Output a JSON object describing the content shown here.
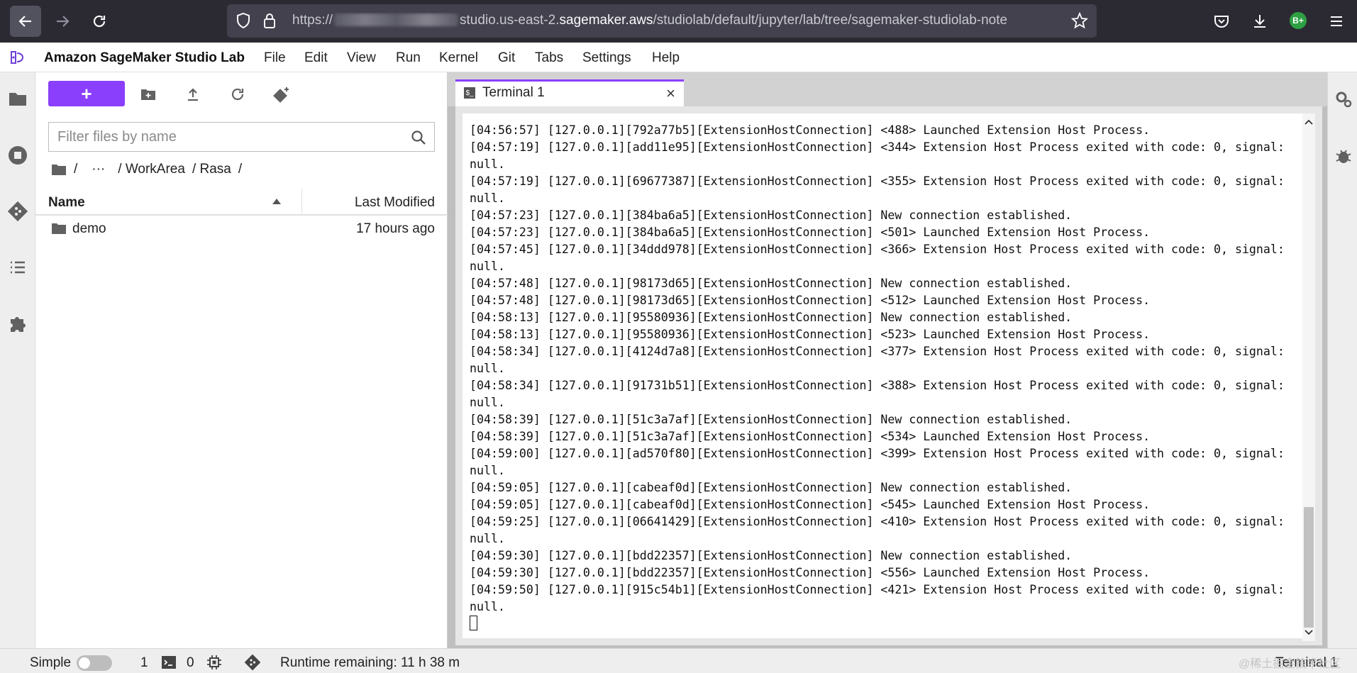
{
  "browser": {
    "url_prefix": "https://",
    "url_host_before": "studio.us-east-2.",
    "url_host": "sagemaker.aws",
    "url_path": "/studiolab/default/jupyter/lab/tree/sagemaker-studiolab-note",
    "profile_label": "B+"
  },
  "menubar": {
    "title": "Amazon SageMaker Studio Lab",
    "items": [
      "File",
      "Edit",
      "View",
      "Run",
      "Kernel",
      "Git",
      "Tabs",
      "Settings",
      "Help"
    ]
  },
  "filebrowser": {
    "new_label": "+",
    "filter_placeholder": "Filter files by name",
    "breadcrumb": [
      "/",
      "···",
      "/ WorkArea",
      "/ Rasa",
      "/"
    ],
    "columns": {
      "name": "Name",
      "modified": "Last Modified"
    },
    "rows": [
      {
        "name": "demo",
        "modified": "17 hours ago"
      }
    ]
  },
  "tab": {
    "label": "Terminal 1",
    "close": "×"
  },
  "terminal": {
    "lines": [
      "[04:56:57] [127.0.0.1][792a77b5][ExtensionHostConnection] <488> Launched Extension Host Process.",
      "[04:57:19] [127.0.0.1][add11e95][ExtensionHostConnection] <344> Extension Host Process exited with code: 0, signal:",
      "null.",
      "[04:57:19] [127.0.0.1][69677387][ExtensionHostConnection] <355> Extension Host Process exited with code: 0, signal:",
      "null.",
      "[04:57:23] [127.0.0.1][384ba6a5][ExtensionHostConnection] New connection established.",
      "[04:57:23] [127.0.0.1][384ba6a5][ExtensionHostConnection] <501> Launched Extension Host Process.",
      "[04:57:45] [127.0.0.1][34ddd978][ExtensionHostConnection] <366> Extension Host Process exited with code: 0, signal:",
      "null.",
      "[04:57:48] [127.0.0.1][98173d65][ExtensionHostConnection] New connection established.",
      "[04:57:48] [127.0.0.1][98173d65][ExtensionHostConnection] <512> Launched Extension Host Process.",
      "[04:58:13] [127.0.0.1][95580936][ExtensionHostConnection] New connection established.",
      "[04:58:13] [127.0.0.1][95580936][ExtensionHostConnection] <523> Launched Extension Host Process.",
      "[04:58:34] [127.0.0.1][4124d7a8][ExtensionHostConnection] <377> Extension Host Process exited with code: 0, signal:",
      "null.",
      "[04:58:34] [127.0.0.1][91731b51][ExtensionHostConnection] <388> Extension Host Process exited with code: 0, signal:",
      "null.",
      "[04:58:39] [127.0.0.1][51c3a7af][ExtensionHostConnection] New connection established.",
      "[04:58:39] [127.0.0.1][51c3a7af][ExtensionHostConnection] <534> Launched Extension Host Process.",
      "[04:59:00] [127.0.0.1][ad570f80][ExtensionHostConnection] <399> Extension Host Process exited with code: 0, signal:",
      "null.",
      "[04:59:05] [127.0.0.1][cabeaf0d][ExtensionHostConnection] New connection established.",
      "[04:59:05] [127.0.0.1][cabeaf0d][ExtensionHostConnection] <545> Launched Extension Host Process.",
      "[04:59:25] [127.0.0.1][06641429][ExtensionHostConnection] <410> Extension Host Process exited with code: 0, signal:",
      "null.",
      "[04:59:30] [127.0.0.1][bdd22357][ExtensionHostConnection] New connection established.",
      "[04:59:30] [127.0.0.1][bdd22357][ExtensionHostConnection] <556> Launched Extension Host Process.",
      "[04:59:50] [127.0.0.1][915c54b1][ExtensionHostConnection] <421> Extension Host Process exited with code: 0, signal:",
      "null."
    ]
  },
  "statusbar": {
    "mode": "Simple",
    "terminals_count": "1",
    "kernels_count": "0",
    "runtime": "Runtime remaining: 11 h 38 m",
    "active_tab": "Terminal 1",
    "watermark": "@稀土掘金技术社区"
  },
  "colors": {
    "accent": "#8a3ffc",
    "browser_bg": "#2b2a33",
    "urlbar_bg": "#42414d"
  }
}
